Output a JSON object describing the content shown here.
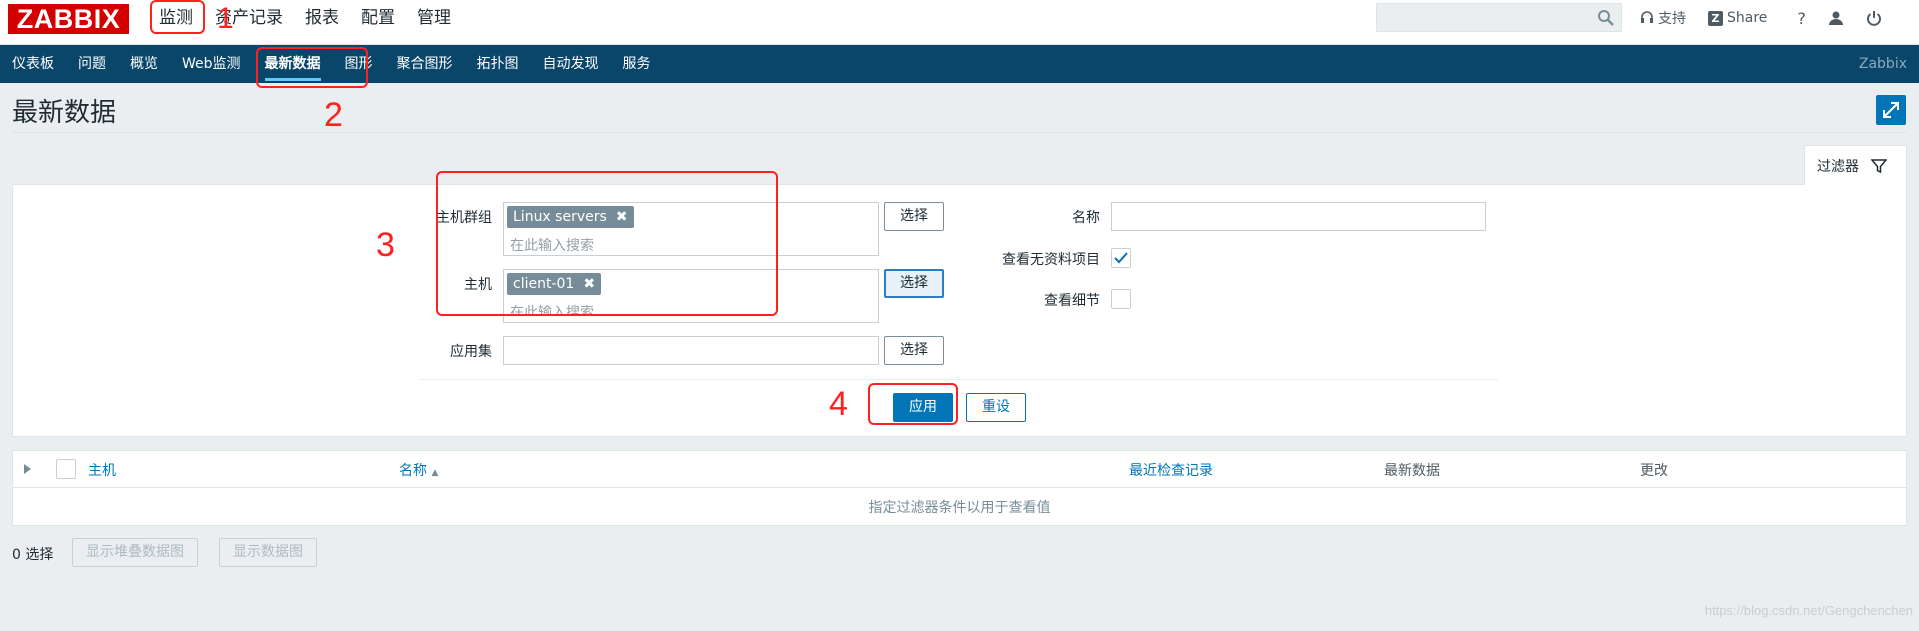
{
  "header": {
    "logo": "ZABBIX",
    "nav": [
      "监测",
      "资产记录",
      "报表",
      "配置",
      "管理"
    ],
    "search_placeholder": "",
    "support_label": "支持",
    "share_label": "Share",
    "help_label": "?"
  },
  "subnav": {
    "items": [
      "仪表板",
      "问题",
      "概览",
      "Web监测",
      "最新数据",
      "图形",
      "聚合图形",
      "拓扑图",
      "自动发现",
      "服务"
    ],
    "active": "最新数据",
    "brand": "Zabbix"
  },
  "page": {
    "title": "最新数据"
  },
  "filter": {
    "tab_label": "过滤器",
    "host_group_label": "主机群组",
    "host_group_tag": "Linux servers",
    "host_label": "主机",
    "host_tag": "client-01",
    "search_placeholder": "在此输入搜索",
    "app_label": "应用集",
    "select_label": "选择",
    "name_label": "名称",
    "name_value": "",
    "show_no_data_label": "查看无资料项目",
    "show_no_data_checked": true,
    "show_details_label": "查看细节",
    "show_details_checked": false,
    "apply_label": "应用",
    "reset_label": "重设"
  },
  "annotations": {
    "n1": "1",
    "n2": "2",
    "n3": "3",
    "n4": "4"
  },
  "table": {
    "col_host": "主机",
    "col_name": "名称",
    "col_last_check": "最近检查记录",
    "col_last_value": "最新数据",
    "col_change": "更改",
    "empty_text": "指定过滤器条件以用于查看值"
  },
  "footer": {
    "selected": "0 选择",
    "btn_stacked": "显示堆叠数据图",
    "btn_graph": "显示数据图"
  },
  "watermark": "https://blog.csdn.net/Gengchenchen",
  "colors": {
    "accent": "#0275b8",
    "subnav_bg": "#0a466a",
    "logo_bg": "#d40000",
    "annotation": "#ff2020"
  }
}
